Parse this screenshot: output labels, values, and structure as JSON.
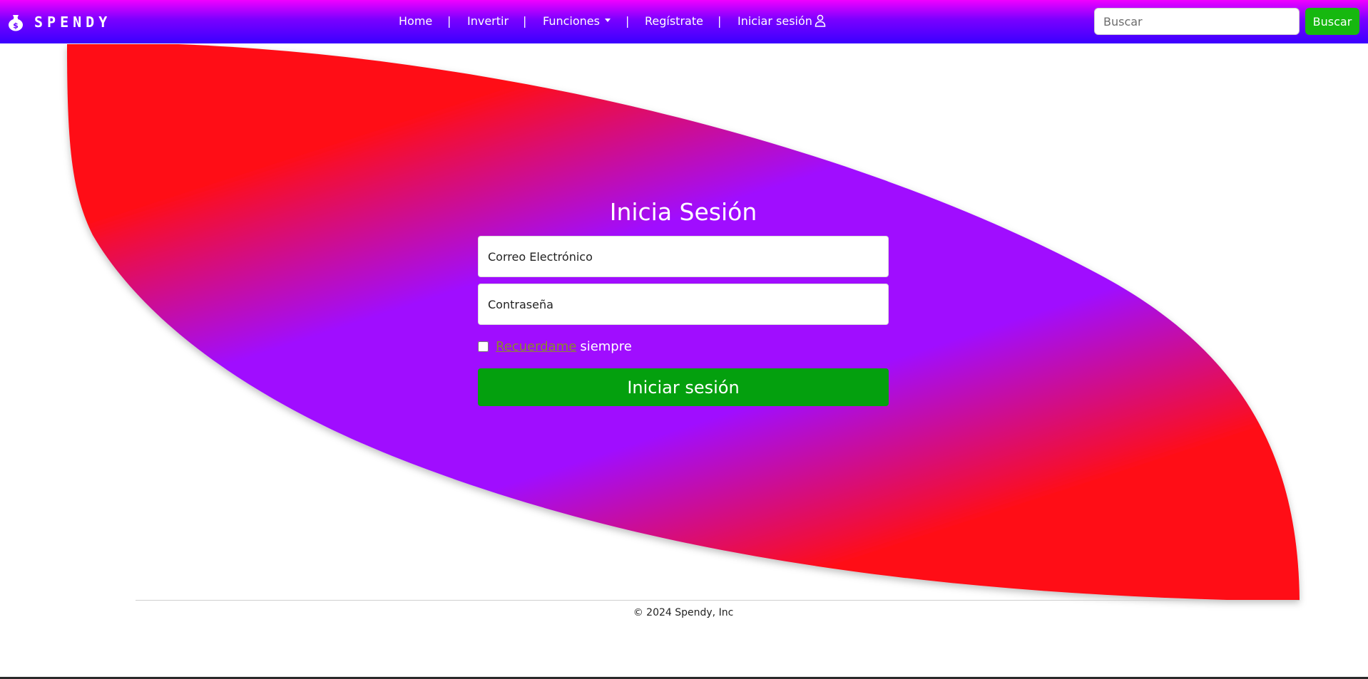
{
  "navbar": {
    "brand": "SPENDY",
    "brand_icon": "money-bag-icon",
    "links": {
      "home": "Home",
      "invest": "Invertir",
      "functions": "Funciones",
      "register": "Regístrate",
      "login": "Iniciar sesión"
    },
    "separator": "|",
    "search": {
      "placeholder": "Buscar",
      "button": "Buscar"
    },
    "user_icon": "user-icon"
  },
  "login": {
    "title": "Inicia Sesión",
    "email_placeholder": "Correo Electrónico",
    "password_placeholder": "Contraseña",
    "remember_link": "Recuerdame",
    "remember_text": "siempre",
    "submit": "Iniciar sesión"
  },
  "footer": {
    "copyright": "© 2024 Spendy, Inc"
  },
  "colors": {
    "navbar_top": "#f000ff",
    "navbar_bottom": "#3a00ff",
    "hero_outer": "#ff0000",
    "hero_center": "#a010ff",
    "search_button": "#16b80f",
    "submit_button": "#04a00e",
    "remember_link": "#8a8a2a"
  }
}
